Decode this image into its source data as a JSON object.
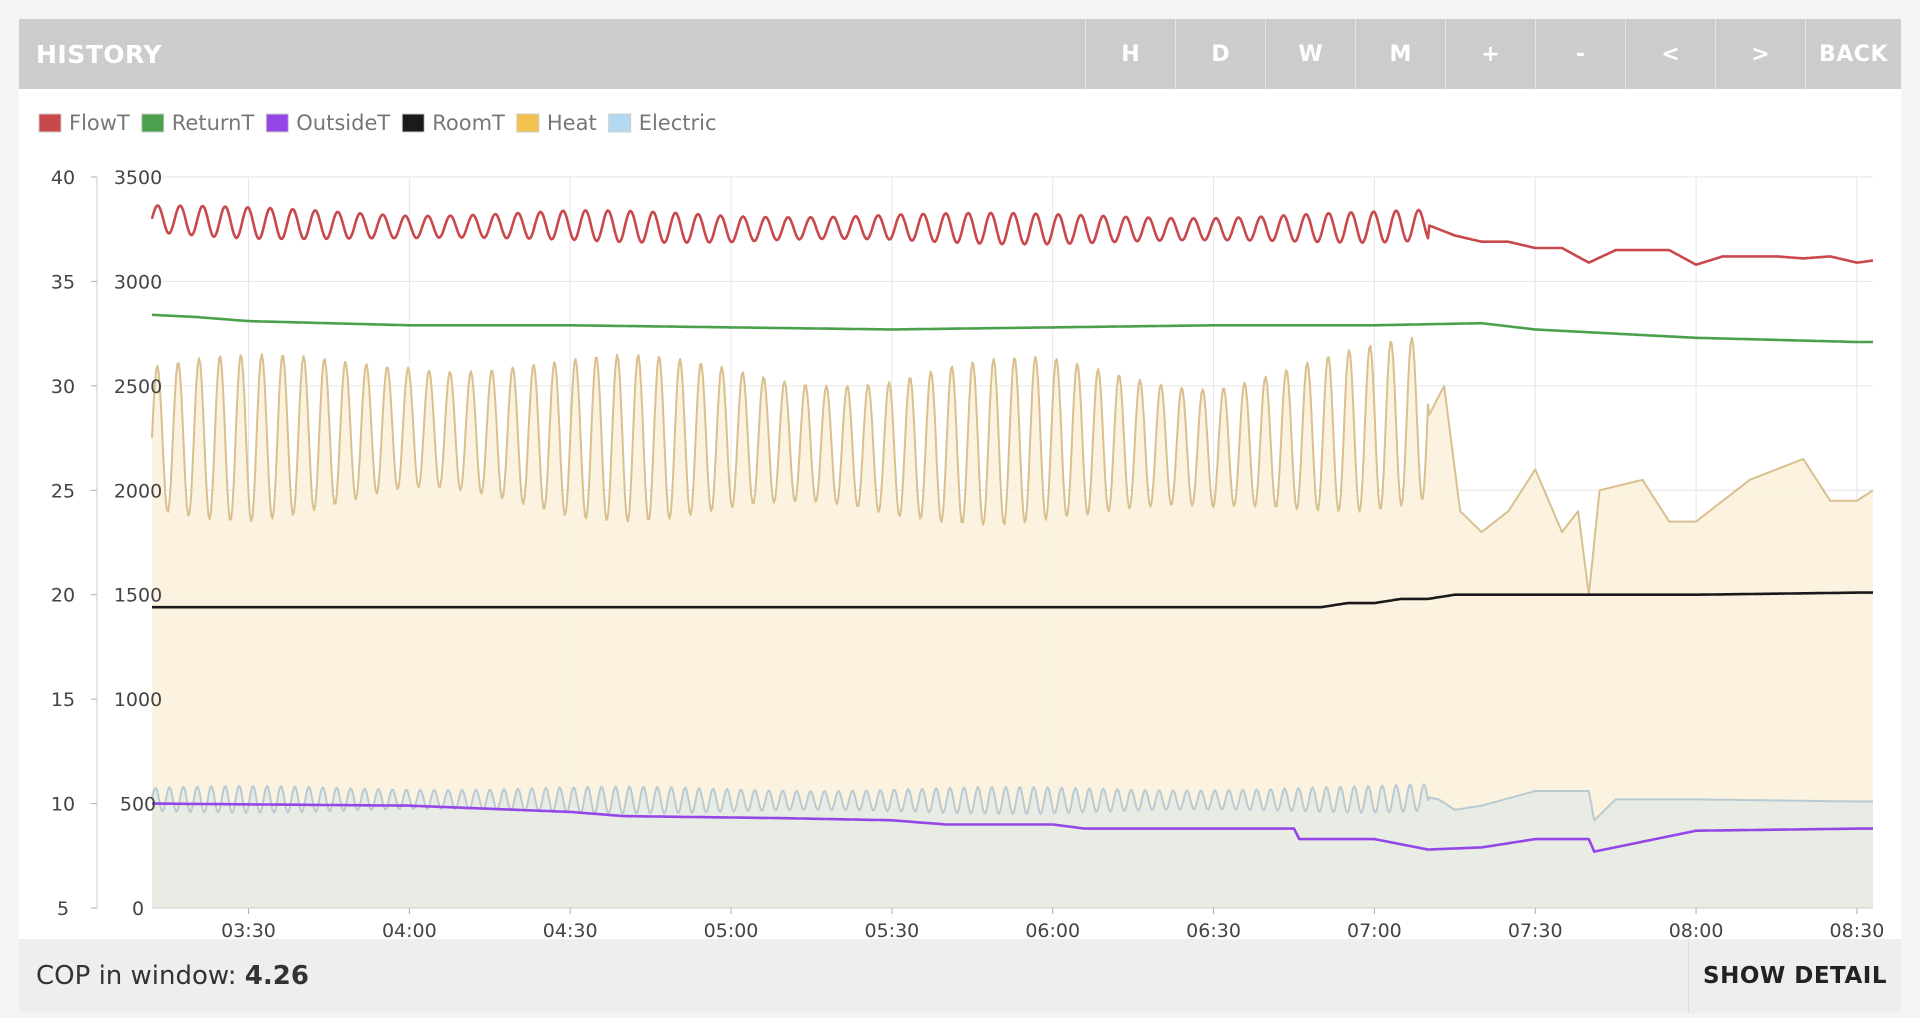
{
  "header": {
    "title": "HISTORY",
    "buttons": [
      {
        "label": "H"
      },
      {
        "label": "D"
      },
      {
        "label": "W"
      },
      {
        "label": "M"
      },
      {
        "label": "+"
      },
      {
        "label": "-"
      },
      {
        "label": "<"
      },
      {
        "label": ">"
      },
      {
        "label": "BACK"
      }
    ]
  },
  "footer": {
    "cop_label": "COP in window:",
    "cop_value": "4.26",
    "detail_label": "SHOW DETAIL"
  },
  "chart_data": {
    "type": "line",
    "x_range": [
      "03:12",
      "08:33"
    ],
    "x_ticks": [
      "03:30",
      "04:00",
      "04:30",
      "05:00",
      "05:30",
      "06:00",
      "06:30",
      "07:00",
      "07:30",
      "08:00",
      "08:30"
    ],
    "y_left": {
      "range": [
        5,
        40
      ],
      "ticks": [
        5,
        10,
        15,
        20,
        25,
        30,
        35,
        40
      ]
    },
    "y_right": {
      "range": [
        0,
        3500
      ],
      "ticks": [
        0,
        500,
        1000,
        1500,
        2000,
        2500,
        3000,
        3500
      ]
    },
    "grid": true,
    "legend_position": "top-left",
    "series": [
      {
        "name": "FlowT",
        "axis": "left",
        "color": "#c9484c",
        "fill": false,
        "x": [
          "03:12",
          "03:30",
          "04:00",
          "04:30",
          "05:00",
          "05:30",
          "06:00",
          "06:30",
          "07:00",
          "07:10",
          "07:15",
          "07:20",
          "07:25",
          "07:30",
          "07:35",
          "07:40",
          "07:45",
          "07:50",
          "07:55",
          "08:00",
          "08:05",
          "08:10",
          "08:15",
          "08:20",
          "08:25",
          "08:30",
          "08:33"
        ],
        "y": [
          38.0,
          37.8,
          37.6,
          37.7,
          37.5,
          37.6,
          37.5,
          37.5,
          37.6,
          37.7,
          37.2,
          36.9,
          36.9,
          36.6,
          36.6,
          35.9,
          36.5,
          36.5,
          36.5,
          35.8,
          36.2,
          36.2,
          36.2,
          36.1,
          36.2,
          35.9,
          36.0
        ],
        "oscillation": {
          "from": "03:12",
          "to": "07:10",
          "amplitude": 0.75,
          "period_min": 4.2
        }
      },
      {
        "name": "ReturnT",
        "axis": "left",
        "color": "#4aa04c",
        "fill": false,
        "x": [
          "03:12",
          "03:20",
          "03:30",
          "04:00",
          "04:30",
          "05:00",
          "05:30",
          "06:00",
          "06:30",
          "07:00",
          "07:20",
          "07:30",
          "08:00",
          "08:30",
          "08:33"
        ],
        "y": [
          33.4,
          33.3,
          33.1,
          32.9,
          32.9,
          32.8,
          32.7,
          32.8,
          32.9,
          32.9,
          33.0,
          32.7,
          32.3,
          32.1,
          32.1
        ]
      },
      {
        "name": "OutsideT",
        "axis": "left",
        "color": "#9546e6",
        "fill": false,
        "x": [
          "03:12",
          "04:00",
          "04:30",
          "04:40",
          "05:10",
          "05:30",
          "05:40",
          "06:00",
          "06:06",
          "06:45",
          "06:46",
          "07:00",
          "07:10",
          "07:20",
          "07:30",
          "07:40",
          "07:41",
          "08:00",
          "08:30",
          "08:33"
        ],
        "y": [
          10.0,
          9.9,
          9.6,
          9.4,
          9.3,
          9.2,
          9.0,
          9.0,
          8.8,
          8.8,
          8.3,
          8.3,
          7.8,
          7.9,
          8.3,
          8.3,
          7.7,
          8.7,
          8.8,
          8.8
        ]
      },
      {
        "name": "RoomT",
        "axis": "left",
        "color": "#1a1a1a",
        "fill": false,
        "x": [
          "03:12",
          "05:00",
          "06:00",
          "06:45",
          "06:50",
          "06:55",
          "07:00",
          "07:05",
          "07:10",
          "07:15",
          "08:00",
          "08:30",
          "08:33"
        ],
        "y": [
          19.4,
          19.4,
          19.4,
          19.4,
          19.4,
          19.6,
          19.6,
          19.8,
          19.8,
          20.0,
          20.0,
          20.1,
          20.1
        ]
      },
      {
        "name": "Heat",
        "axis": "right",
        "color": "#f2c14e",
        "line_color": "#d9c08e",
        "fill": true,
        "fill_color": "#fbf1dd",
        "x": [
          "03:12",
          "03:30",
          "04:00",
          "04:30",
          "05:00",
          "05:30",
          "06:00",
          "06:30",
          "07:00",
          "07:10",
          "07:13",
          "07:16",
          "07:20",
          "07:25",
          "07:30",
          "07:35",
          "07:38",
          "07:40",
          "07:42",
          "07:50",
          "07:55",
          "08:00",
          "08:10",
          "08:20",
          "08:25",
          "08:30",
          "08:33"
        ],
        "y": [
          2250,
          2250,
          2300,
          2250,
          2250,
          2200,
          2250,
          2200,
          2300,
          2350,
          2500,
          1900,
          1800,
          1900,
          2100,
          1800,
          1900,
          1500,
          2000,
          2050,
          1850,
          1850,
          2050,
          2150,
          1950,
          1950,
          2000
        ],
        "oscillation": {
          "from": "03:12",
          "to": "07:10",
          "amplitude": 400,
          "period_min": 3.9
        }
      },
      {
        "name": "Electric",
        "axis": "right",
        "color": "#b3d9f2",
        "line_color": "#b9cbd2",
        "fill": true,
        "fill_color": "#e6ebe4",
        "x": [
          "03:12",
          "04:00",
          "05:00",
          "06:00",
          "07:00",
          "07:10",
          "07:12",
          "07:15",
          "07:20",
          "07:30",
          "07:40",
          "07:41",
          "07:45",
          "08:00",
          "08:30",
          "08:33"
        ],
        "y": [
          520,
          520,
          515,
          515,
          520,
          530,
          520,
          470,
          490,
          560,
          560,
          420,
          520,
          520,
          510,
          510
        ],
        "oscillation": {
          "from": "03:12",
          "to": "07:10",
          "amplitude": 65,
          "period_min": 2.6
        }
      }
    ]
  }
}
